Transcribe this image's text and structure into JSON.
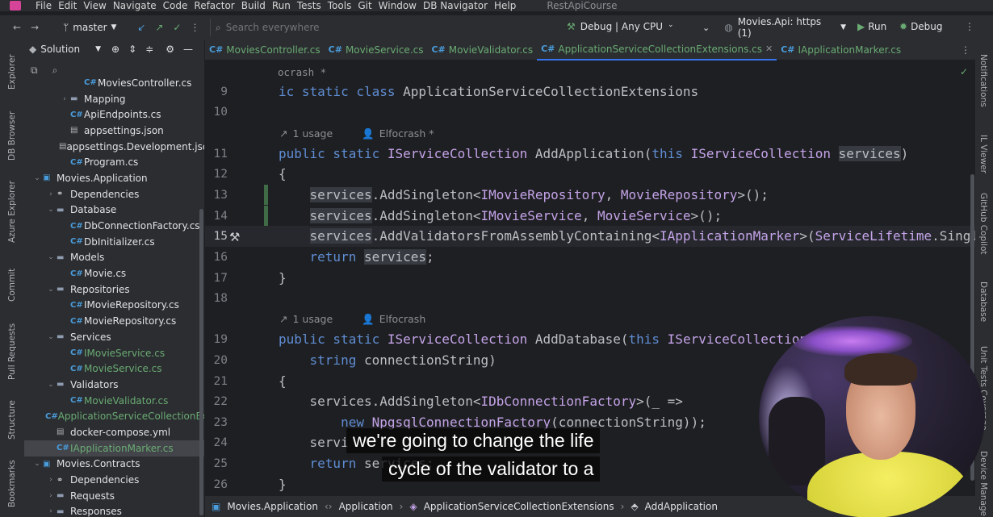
{
  "menu": {
    "items": [
      "File",
      "Edit",
      "View",
      "Navigate",
      "Code",
      "Refactor",
      "Build",
      "Run",
      "Tests",
      "Tools",
      "Git",
      "Window",
      "DB Navigator",
      "Help"
    ],
    "project_name": "RestApiCourse"
  },
  "toolbar": {
    "branch": "master",
    "search_placeholder": "Search everywhere",
    "build_config": "Debug | Any CPU",
    "run_config": "Movies.Api: https (1)",
    "run_label": "Run",
    "debug_label": "Debug"
  },
  "left_strip": {
    "labels": [
      "Explorer",
      "DB Browser",
      "Azure Explorer",
      "Commit",
      "Pull Requests",
      "Structure",
      "Bookmarks"
    ]
  },
  "right_strip": {
    "labels": [
      "Notifications",
      "IL Viewer",
      "GitHub Copilot",
      "Database",
      "Unit Tests Coverage",
      "Device Manager"
    ]
  },
  "panel": {
    "title": "Solution",
    "tree": [
      {
        "label": "MoviesController.cs",
        "type": "cs",
        "depth": 4,
        "arrow": ""
      },
      {
        "label": "Mapping",
        "type": "folder",
        "depth": 3,
        "arrow": "›"
      },
      {
        "label": "ApiEndpoints.cs",
        "type": "cs",
        "depth": 3,
        "arrow": ""
      },
      {
        "label": "appsettings.json",
        "type": "file",
        "depth": 3,
        "arrow": ""
      },
      {
        "label": "appsettings.Development.json",
        "type": "file",
        "depth": 3,
        "arrow": ""
      },
      {
        "label": "Program.cs",
        "type": "cs",
        "depth": 3,
        "arrow": ""
      },
      {
        "label": "Movies.Application",
        "type": "proj",
        "depth": 1,
        "arrow": "⌄"
      },
      {
        "label": "Dependencies",
        "type": "dep",
        "depth": 2,
        "arrow": "›"
      },
      {
        "label": "Database",
        "type": "folder",
        "depth": 2,
        "arrow": "⌄"
      },
      {
        "label": "DbConnectionFactory.cs",
        "type": "cs",
        "depth": 3,
        "arrow": ""
      },
      {
        "label": "DbInitializer.cs",
        "type": "cs",
        "depth": 3,
        "arrow": ""
      },
      {
        "label": "Models",
        "type": "folder",
        "depth": 2,
        "arrow": "⌄"
      },
      {
        "label": "Movie.cs",
        "type": "cs",
        "depth": 3,
        "arrow": ""
      },
      {
        "label": "Repositories",
        "type": "folder",
        "depth": 2,
        "arrow": "⌄"
      },
      {
        "label": "IMovieRepository.cs",
        "type": "cs",
        "depth": 3,
        "arrow": ""
      },
      {
        "label": "MovieRepository.cs",
        "type": "cs",
        "depth": 3,
        "arrow": ""
      },
      {
        "label": "Services",
        "type": "folder",
        "depth": 2,
        "arrow": "⌄"
      },
      {
        "label": "IMovieService.cs",
        "type": "cs",
        "depth": 3,
        "arrow": "",
        "modified": true
      },
      {
        "label": "MovieService.cs",
        "type": "cs",
        "depth": 3,
        "arrow": "",
        "modified": true
      },
      {
        "label": "Validators",
        "type": "folder",
        "depth": 2,
        "arrow": "⌄"
      },
      {
        "label": "MovieValidator.cs",
        "type": "cs",
        "depth": 3,
        "arrow": "",
        "modified": true
      },
      {
        "label": "ApplicationServiceCollectionEx",
        "type": "cs",
        "depth": 2,
        "arrow": "",
        "modified": true
      },
      {
        "label": "docker-compose.yml",
        "type": "file",
        "depth": 2,
        "arrow": ""
      },
      {
        "label": "IApplicationMarker.cs",
        "type": "cs",
        "depth": 2,
        "arrow": "",
        "modified": true,
        "selected": true
      },
      {
        "label": "Movies.Contracts",
        "type": "proj",
        "depth": 1,
        "arrow": "⌄"
      },
      {
        "label": "Dependencies",
        "type": "dep",
        "depth": 2,
        "arrow": "›"
      },
      {
        "label": "Requests",
        "type": "folder",
        "depth": 2,
        "arrow": "›"
      },
      {
        "label": "Responses",
        "type": "folder",
        "depth": 2,
        "arrow": "›"
      }
    ]
  },
  "tabs": [
    {
      "label": "MoviesController.cs",
      "modified": true,
      "active": false
    },
    {
      "label": "MovieService.cs",
      "modified": true,
      "active": false
    },
    {
      "label": "MovieValidator.cs",
      "modified": true,
      "active": false
    },
    {
      "label": "ApplicationServiceCollectionExtensions.cs",
      "modified": true,
      "active": true
    },
    {
      "label": "IApplicationMarker.cs",
      "modified": true,
      "active": false
    }
  ],
  "editor": {
    "top_fragment": "ocrash *",
    "hint1": {
      "usage": "1 usage",
      "author": "Elfocrash *"
    },
    "hint2": {
      "usage": "1 usage",
      "author": "Elfocrash"
    },
    "line_numbers": [
      "9",
      "10",
      "11",
      "12",
      "13",
      "14",
      "15",
      "16",
      "17",
      "18",
      "19",
      "20",
      "21",
      "22",
      "23",
      "24",
      "25",
      "26"
    ]
  },
  "breadcrumb": {
    "items": [
      "Movies.Application",
      "Application",
      "ApplicationServiceCollectionExtensions",
      "AddApplication"
    ]
  },
  "subtitle": {
    "line1": "we're going to change the life",
    "line2": "cycle of the validator to a"
  }
}
